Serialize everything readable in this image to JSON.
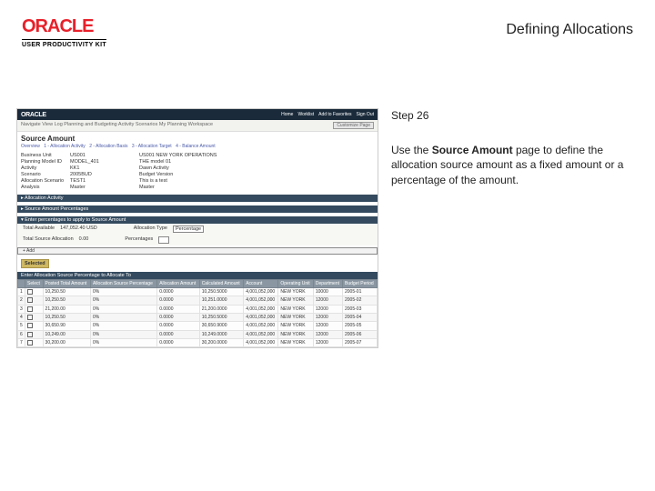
{
  "header": {
    "brand": "ORACLE",
    "subbrand": "USER PRODUCTIVITY KIT",
    "title": "Defining Allocations"
  },
  "step": {
    "label": "Step 26",
    "body_pre": "Use the ",
    "body_bold": "Source Amount",
    "body_post": " page to define the allocation source amount as a fixed amount or a percentage of the amount."
  },
  "app": {
    "brand": "ORACLE",
    "top_links": [
      "Home",
      "Worklist",
      "Add to Favorites",
      "Sign Out"
    ],
    "crumb": "Navigate   View Log   Planning and Budgeting   Activity Scenarios   My Planning Workspace",
    "customize": "Customize Page",
    "section_title": "Source Amount",
    "steps": [
      "Overview",
      "1 - Allocation Activity",
      "2 - Allocation Basis",
      "3 - Allocation Target",
      "4 - Balance Amount"
    ],
    "fields": {
      "bu_l": "Business Unit",
      "bu_v": "US001",
      "bu_d": "US001 NEW YORK OPERATIONS",
      "pm_l": "Planning Model ID",
      "pm_v": "MODEL_401",
      "pm_d": "THE model 01",
      "ac_l": "Activity",
      "ac_v": "KK1",
      "ac_d": "Dawn Activity",
      "sc_l": "Scenario",
      "sc_v": "2005BUD",
      "sc_d": "Budget Version",
      "as_l": "Allocation Scenario",
      "as_v": "TEST1",
      "as_d": "This is a test",
      "an_l": "Analysis",
      "an_v": "Master",
      "an_d": "Master"
    },
    "bars": {
      "b1": "▸ Allocation Activity",
      "b2": "▸ Source Amount Percentages",
      "b3": "▾ Enter percentages to apply to Source Amount"
    },
    "summary": {
      "ta_l": "Total Available",
      "ta_v": "147,052.40   USD",
      "tsa_l": "Total Source Allocation",
      "tsa_v": "0.00",
      "at_l": "Allocation Type",
      "at_v": "Percentage",
      "pc_l": "Percentages"
    },
    "add_btn": "+ Add",
    "tab": "Selected",
    "grid_title": "Enter Allocation Source Percentage to Allocate To",
    "cols": [
      "",
      "Select",
      "Posted Total Amount",
      "Allocation Source Percentage",
      "Allocation Amount",
      "Calculated Amount",
      "Account",
      "Operating Unit",
      "Department",
      "Budget Period"
    ],
    "rows": [
      [
        "1",
        "",
        "10,250.50",
        "0%",
        "0.0000",
        "10,250.5000",
        "4,001,052,000",
        "NEW YORK",
        "10000",
        "2005-01"
      ],
      [
        "2",
        "",
        "10,250.50",
        "0%",
        "0.0000",
        "10,251.0000",
        "4,001,052,000",
        "NEW YORK",
        "12000",
        "2005-02"
      ],
      [
        "3",
        "",
        "21,200.00",
        "0%",
        "0.0000",
        "21,200.0000",
        "4,001,052,000",
        "NEW YORK",
        "12000",
        "2005-03"
      ],
      [
        "4",
        "",
        "10,250.50",
        "0%",
        "0.0000",
        "10,250.5000",
        "4,001,052,000",
        "NEW YORK",
        "12000",
        "2005-04"
      ],
      [
        "5",
        "",
        "30,650.90",
        "0%",
        "0.0000",
        "30,650.9000",
        "4,001,052,000",
        "NEW YORK",
        "12000",
        "2005-05"
      ],
      [
        "6",
        "",
        "10,249.00",
        "0%",
        "0.0000",
        "10,249.0000",
        "4,001,052,000",
        "NEW YORK",
        "12000",
        "2005-06"
      ],
      [
        "7",
        "",
        "30,200.00",
        "0%",
        "0.0000",
        "30,200.0000",
        "4,001,052,000",
        "NEW YORK",
        "12000",
        "2005-07"
      ]
    ]
  }
}
